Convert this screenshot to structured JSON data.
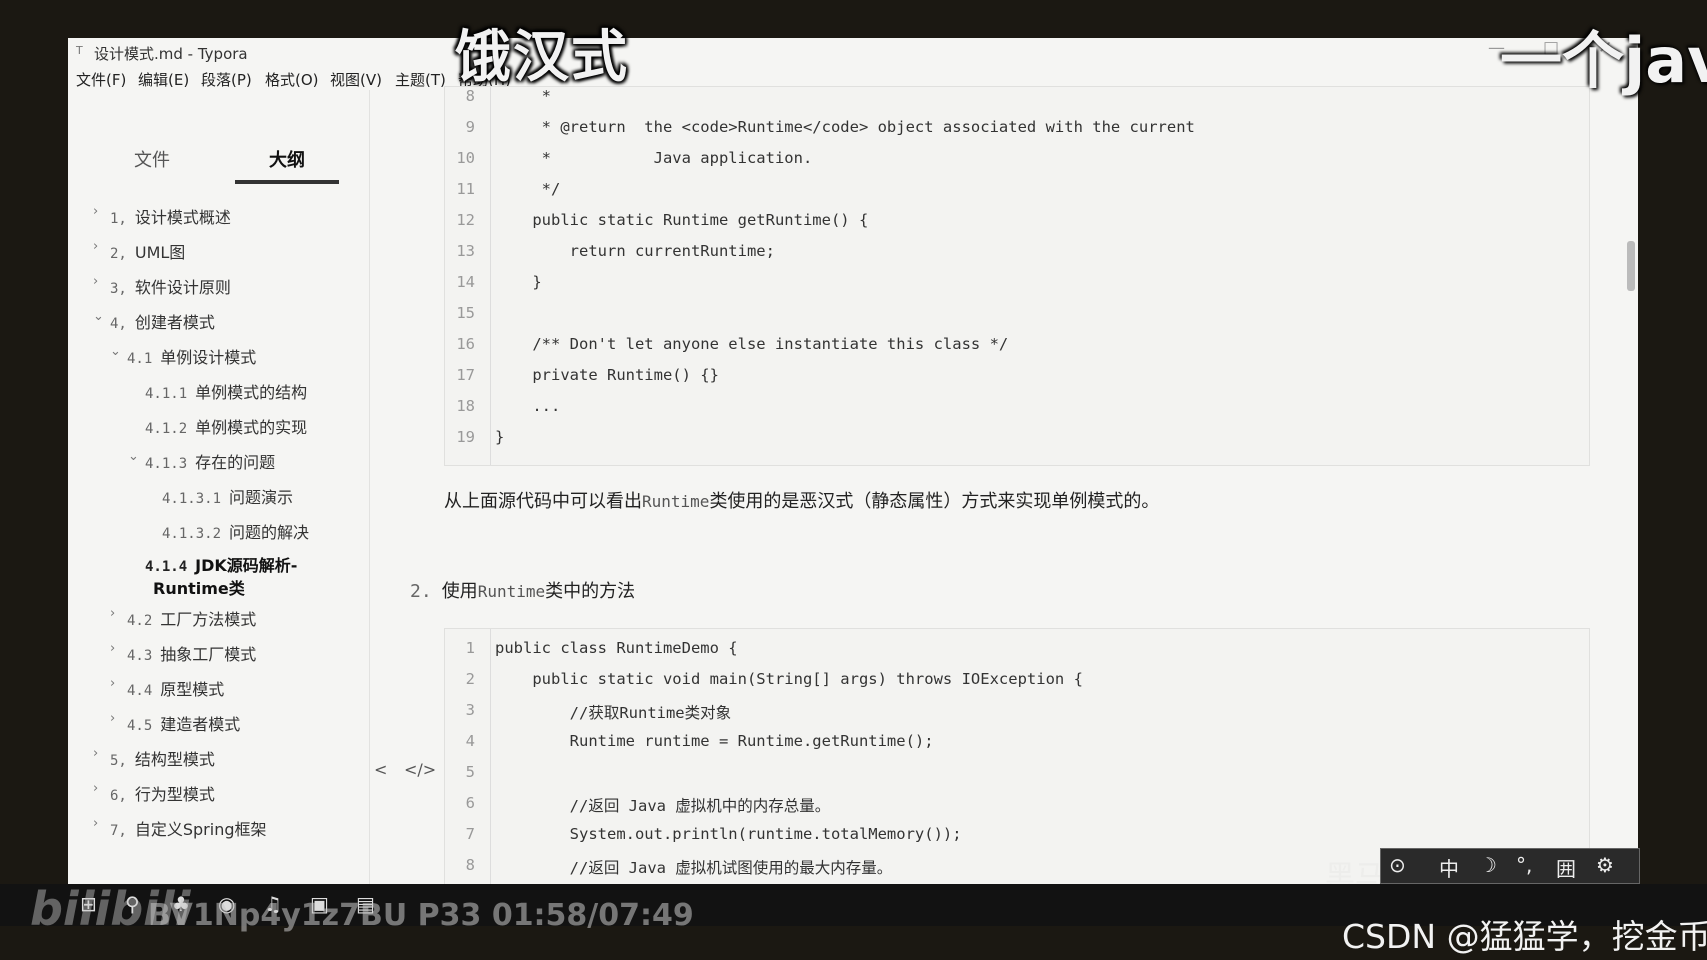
{
  "overlay": {
    "title": "饿汉式",
    "corner_text": "一个jav",
    "video_info": "BV1Np4y1z7BU P33 01:58/07:49",
    "bili_logo": "bilibili",
    "csdn": "CSDN @猛猛学，挖金币",
    "watermark": "黑马程序员"
  },
  "window": {
    "title": "设计模式.md - Typora",
    "minimize": "—",
    "maximize": "□",
    "close": "✕"
  },
  "menu": [
    "文件(F)",
    "编辑(E)",
    "段落(P)",
    "格式(O)",
    "视图(V)",
    "主题(T)",
    "帮助(H)"
  ],
  "sidebar": {
    "tabs": [
      "文件",
      "大纲"
    ],
    "outline": [
      {
        "num": "1,",
        "label": "设计模式概述"
      },
      {
        "num": "2,",
        "label": "UML图"
      },
      {
        "num": "3,",
        "label": "软件设计原则"
      },
      {
        "num": "4,",
        "label": "创建者模式"
      },
      {
        "num": "4.1",
        "label": "单例设计模式"
      },
      {
        "num": "4.1.1",
        "label": "单例模式的结构"
      },
      {
        "num": "4.1.2",
        "label": "单例模式的实现"
      },
      {
        "num": "4.1.3",
        "label": "存在的问题"
      },
      {
        "num": "4.1.3.1",
        "label": "问题演示"
      },
      {
        "num": "4.1.3.2",
        "label": "问题的解决"
      },
      {
        "num": "4.1.4",
        "label": "JDK源码解析-"
      },
      {
        "num": "",
        "label": "Runtime类"
      },
      {
        "num": "4.2",
        "label": "工厂方法模式"
      },
      {
        "num": "4.3",
        "label": "抽象工厂模式"
      },
      {
        "num": "4.4",
        "label": "原型模式"
      },
      {
        "num": "4.5",
        "label": "建造者模式"
      },
      {
        "num": "5,",
        "label": "结构型模式"
      },
      {
        "num": "6,",
        "label": "行为型模式"
      },
      {
        "num": "7,",
        "label": "自定义Spring框架"
      }
    ],
    "bottom_left": "<",
    "bottom_right": "</>"
  },
  "code_block_1": {
    "line_numbers": [
      "8",
      "9",
      "10",
      "11",
      "12",
      "13",
      "14",
      "15",
      "16",
      "17",
      "18",
      "19"
    ],
    "lines": [
      "     *",
      "     * @return  the <code>Runtime</code> object associated with the current",
      "     *           Java application.",
      "     */",
      "    public static Runtime getRuntime() {",
      "        return currentRuntime;",
      "    }",
      "",
      "    /** Don't let anyone else instantiate this class */",
      "    private Runtime() {}",
      "    ...",
      "}"
    ]
  },
  "paragraph": {
    "before": "从上面源代码中可以看出",
    "mono": "Runtime",
    "after": "类使用的是恶汉式（静态属性）方式来实现单例模式的。"
  },
  "heading2": {
    "num": "2.",
    "before": "使用",
    "mono": "Runtime",
    "after": "类中的方法"
  },
  "code_block_2": {
    "line_numbers": [
      "1",
      "2",
      "3",
      "4",
      "5",
      "6",
      "7",
      "8"
    ],
    "lines": [
      "public class RuntimeDemo {",
      "    public static void main(String[] args) throws IOException {",
      "        //获取Runtime类对象",
      "        Runtime runtime = Runtime.getRuntime();",
      "",
      "        //返回 Java 虚拟机中的内存总量。",
      "        System.out.println(runtime.totalMemory());",
      "        //返回 Java 虚拟机试图使用的最大内存量。"
    ]
  },
  "ime": {
    "items": [
      "⊙",
      "中",
      "☽",
      "°,",
      "囲",
      "⚙"
    ]
  },
  "taskbar": {
    "items": [
      "⊞",
      "⚲",
      "♣",
      "◉",
      "♫",
      "▣",
      "▤"
    ]
  }
}
